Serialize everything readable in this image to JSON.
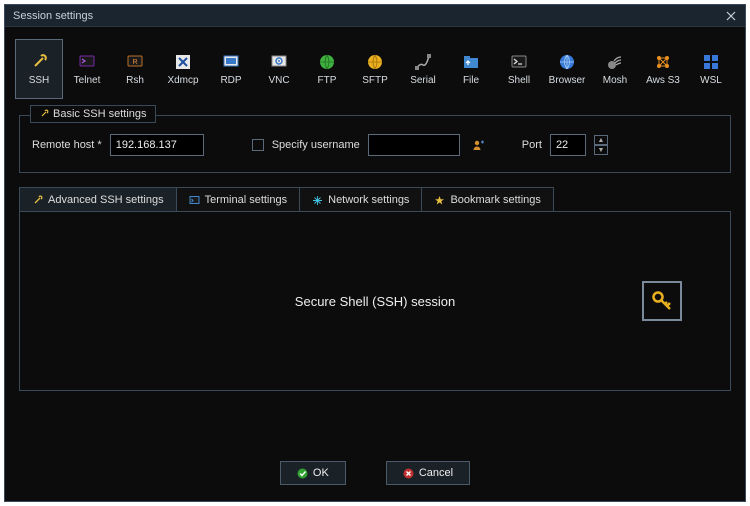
{
  "window": {
    "title": "Session settings"
  },
  "protocols": [
    {
      "label": "SSH",
      "icon": "ssh-icon"
    },
    {
      "label": "Telnet",
      "icon": "telnet-icon"
    },
    {
      "label": "Rsh",
      "icon": "rsh-icon"
    },
    {
      "label": "Xdmcp",
      "icon": "xdmcp-icon"
    },
    {
      "label": "RDP",
      "icon": "rdp-icon"
    },
    {
      "label": "VNC",
      "icon": "vnc-icon"
    },
    {
      "label": "FTP",
      "icon": "ftp-icon"
    },
    {
      "label": "SFTP",
      "icon": "sftp-icon"
    },
    {
      "label": "Serial",
      "icon": "serial-icon"
    },
    {
      "label": "File",
      "icon": "file-icon"
    },
    {
      "label": "Shell",
      "icon": "shell-icon"
    },
    {
      "label": "Browser",
      "icon": "browser-icon"
    },
    {
      "label": "Mosh",
      "icon": "mosh-icon"
    },
    {
      "label": "Aws S3",
      "icon": "aws-icon"
    },
    {
      "label": "WSL",
      "icon": "wsl-icon"
    }
  ],
  "basic": {
    "legend": "Basic SSH settings",
    "host_label": "Remote host *",
    "host_value": "192.168.137",
    "specify_user_label": "Specify username",
    "specify_user_checked": false,
    "user_value": "",
    "port_label": "Port",
    "port_value": "22"
  },
  "tabs": [
    {
      "label": "Advanced SSH settings",
      "icon": "wrench-icon"
    },
    {
      "label": "Terminal settings",
      "icon": "terminal-icon"
    },
    {
      "label": "Network settings",
      "icon": "network-icon"
    },
    {
      "label": "Bookmark settings",
      "icon": "star-icon"
    }
  ],
  "session_name": "Secure Shell (SSH) session",
  "buttons": {
    "ok": "OK",
    "cancel": "Cancel"
  }
}
